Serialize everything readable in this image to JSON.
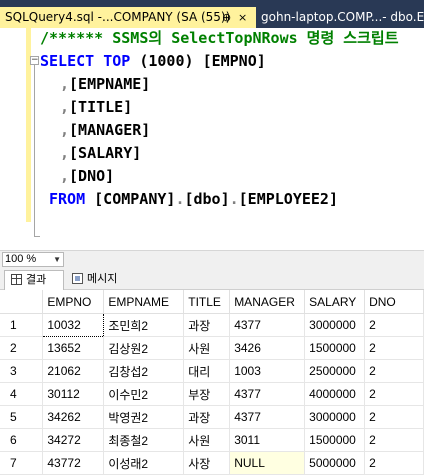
{
  "tabs": [
    {
      "title": "SQLQuery4.sql -...COMPANY (SA (55))",
      "pin": "⊕",
      "close": "×",
      "active": true
    },
    {
      "title": "gohn-laptop.COMP...- dbo.EM",
      "active": false
    }
  ],
  "editor": {
    "comment": "/****** SSMS의 SelectTopNRows 명령 스크립트",
    "select_keyword": "SELECT",
    "top_keyword": "TOP",
    "top_value": "(1000)",
    "first_column": "[EMPNO]",
    "columns": [
      "[EMPNAME]",
      "[TITLE]",
      "[MANAGER]",
      "[SALARY]",
      "[DNO]"
    ],
    "comma": ",",
    "from_keyword": "FROM",
    "table_db": "[COMPANY]",
    "table_schema": "[dbo]",
    "table_name": "[EMPLOYEE2]",
    "dot": "."
  },
  "zoom": {
    "value": "100 %"
  },
  "result_tabs": [
    {
      "label": "결과",
      "icon": "grid-icon",
      "active": true
    },
    {
      "label": "메시지",
      "icon": "message-icon",
      "active": false
    }
  ],
  "grid": {
    "columns": [
      "EMPNO",
      "EMPNAME",
      "TITLE",
      "MANAGER",
      "SALARY",
      "DNO"
    ],
    "rows": [
      {
        "n": "1",
        "cells": [
          "10032",
          "조민희2",
          "과장",
          "4377",
          "3000000",
          "2"
        ]
      },
      {
        "n": "2",
        "cells": [
          "13652",
          "김상원2",
          "사원",
          "3426",
          "1500000",
          "2"
        ]
      },
      {
        "n": "3",
        "cells": [
          "21062",
          "김창섭2",
          "대리",
          "1003",
          "2500000",
          "2"
        ]
      },
      {
        "n": "4",
        "cells": [
          "30112",
          "이수민2",
          "부장",
          "4377",
          "4000000",
          "2"
        ]
      },
      {
        "n": "5",
        "cells": [
          "34262",
          "박영권2",
          "과장",
          "4377",
          "3000000",
          "2"
        ]
      },
      {
        "n": "6",
        "cells": [
          "34272",
          "최종철2",
          "사원",
          "3011",
          "1500000",
          "2"
        ]
      },
      {
        "n": "7",
        "cells": [
          "43772",
          "이성래2",
          "사장",
          "NULL",
          "5000000",
          "2"
        ]
      }
    ]
  },
  "colors": {
    "active_tab": "#fff29d",
    "tabbar": "#293955",
    "keyword": "#0000ff",
    "comment": "#008000",
    "null_cell": "#ffffe1"
  }
}
